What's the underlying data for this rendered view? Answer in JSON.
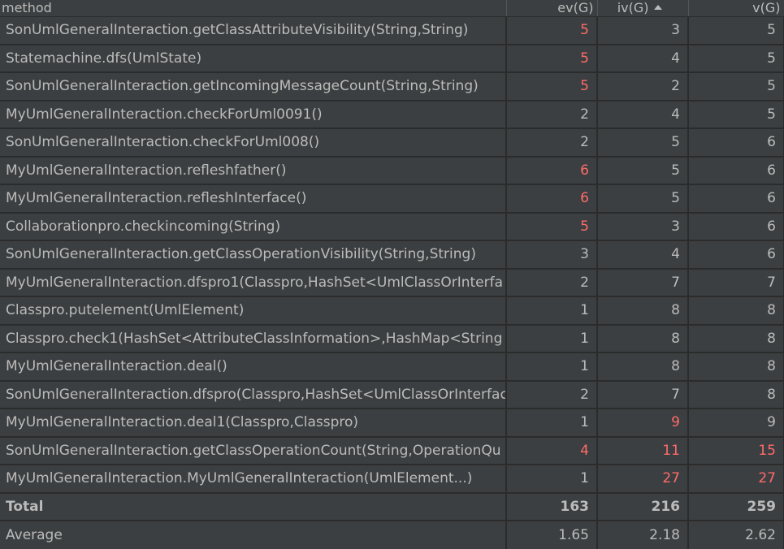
{
  "columns": {
    "method": "method",
    "ev": "ev(G)",
    "iv": "iv(G)",
    "v": "v(G)"
  },
  "sorted_column": "iv(G)",
  "highlight_color": "#ff6b6b",
  "rows": [
    {
      "method": "SonUmlGeneralInteraction.getClassAttributeVisibility(String,String)",
      "ev": "5",
      "iv": "3",
      "v": "5",
      "ev_hot": true,
      "iv_hot": false,
      "v_hot": false
    },
    {
      "method": "Statemachine.dfs(UmlState)",
      "ev": "5",
      "iv": "4",
      "v": "5",
      "ev_hot": true,
      "iv_hot": false,
      "v_hot": false
    },
    {
      "method": "SonUmlGeneralInteraction.getIncomingMessageCount(String,String)",
      "ev": "5",
      "iv": "2",
      "v": "5",
      "ev_hot": true,
      "iv_hot": false,
      "v_hot": false
    },
    {
      "method": "MyUmlGeneralInteraction.checkForUml0091()",
      "ev": "2",
      "iv": "4",
      "v": "5",
      "ev_hot": false,
      "iv_hot": false,
      "v_hot": false
    },
    {
      "method": "SonUmlGeneralInteraction.checkForUml008()",
      "ev": "2",
      "iv": "5",
      "v": "6",
      "ev_hot": false,
      "iv_hot": false,
      "v_hot": false
    },
    {
      "method": "MyUmlGeneralInteraction.refleshfather()",
      "ev": "6",
      "iv": "5",
      "v": "6",
      "ev_hot": true,
      "iv_hot": false,
      "v_hot": false
    },
    {
      "method": "MyUmlGeneralInteraction.refleshInterface()",
      "ev": "6",
      "iv": "5",
      "v": "6",
      "ev_hot": true,
      "iv_hot": false,
      "v_hot": false
    },
    {
      "method": "Collaborationpro.checkincoming(String)",
      "ev": "5",
      "iv": "3",
      "v": "6",
      "ev_hot": true,
      "iv_hot": false,
      "v_hot": false
    },
    {
      "method": "SonUmlGeneralInteraction.getClassOperationVisibility(String,String)",
      "ev": "3",
      "iv": "4",
      "v": "6",
      "ev_hot": false,
      "iv_hot": false,
      "v_hot": false
    },
    {
      "method": "MyUmlGeneralInteraction.dfspro1(Classpro,HashSet<UmlClassOrInterfa",
      "ev": "2",
      "iv": "7",
      "v": "7",
      "ev_hot": false,
      "iv_hot": false,
      "v_hot": false
    },
    {
      "method": "Classpro.putelement(UmlElement)",
      "ev": "1",
      "iv": "8",
      "v": "8",
      "ev_hot": false,
      "iv_hot": false,
      "v_hot": false
    },
    {
      "method": "Classpro.check1(HashSet<AttributeClassInformation>,HashMap<String",
      "ev": "1",
      "iv": "8",
      "v": "8",
      "ev_hot": false,
      "iv_hot": false,
      "v_hot": false
    },
    {
      "method": "MyUmlGeneralInteraction.deal()",
      "ev": "1",
      "iv": "8",
      "v": "8",
      "ev_hot": false,
      "iv_hot": false,
      "v_hot": false
    },
    {
      "method": "SonUmlGeneralInteraction.dfspro(Classpro,HashSet<UmlClassOrInterfac",
      "ev": "2",
      "iv": "7",
      "v": "8",
      "ev_hot": false,
      "iv_hot": false,
      "v_hot": false
    },
    {
      "method": "MyUmlGeneralInteraction.deal1(Classpro,Classpro)",
      "ev": "1",
      "iv": "9",
      "v": "9",
      "ev_hot": false,
      "iv_hot": true,
      "v_hot": false
    },
    {
      "method": "SonUmlGeneralInteraction.getClassOperationCount(String,OperationQu",
      "ev": "4",
      "iv": "11",
      "v": "15",
      "ev_hot": true,
      "iv_hot": true,
      "v_hot": true
    },
    {
      "method": "MyUmlGeneralInteraction.MyUmlGeneralInteraction(UmlElement...)",
      "ev": "1",
      "iv": "27",
      "v": "27",
      "ev_hot": false,
      "iv_hot": true,
      "v_hot": true
    }
  ],
  "total": {
    "label": "Total",
    "ev": "163",
    "iv": "216",
    "v": "259"
  },
  "average": {
    "label": "Average",
    "ev": "1.65",
    "iv": "2.18",
    "v": "2.62"
  }
}
